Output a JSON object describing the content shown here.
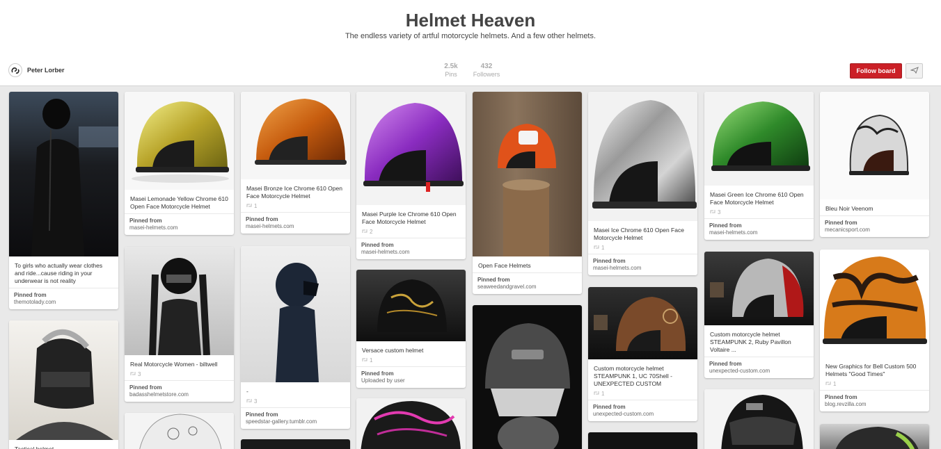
{
  "board": {
    "title": "Helmet Heaven",
    "description": "The endless variety of artful motorcycle helmets. And a few other helmets."
  },
  "owner": {
    "name": "Peter Lorber"
  },
  "stats": {
    "pins_count": "2.5k",
    "pins_label": "Pins",
    "followers_count": "432",
    "followers_label": "Followers"
  },
  "actions": {
    "follow_label": "Follow board"
  },
  "pinned_from_label": "Pinned from",
  "uploaded_by_user_label": "Uploaded by user",
  "pins": [
    {
      "description": "To girls who actually wear clothes and ride...cause riding in your underwear is not reality",
      "repins": "",
      "source": "themotolady.com",
      "image": "woman-leather-helmet"
    },
    {
      "description": "Tactical helmet",
      "repins": "",
      "source": "",
      "image": "tactical-helmet"
    },
    {
      "description": "Masei Lemonade Yellow Chrome 610 Open Face Motorcycle Helmet",
      "repins": "",
      "source": "masei-helmets.com",
      "image": "yellow-chrome-helmet"
    },
    {
      "description": "Real Motorcycle Women - biltwell",
      "repins": "3",
      "source": "badasshelmetstore.com",
      "image": "woman-black-helmet"
    },
    {
      "description": "",
      "repins": "",
      "source": "",
      "image": "white-skull-helmet"
    },
    {
      "description": "Masei Bronze Ice Chrome 610 Open Face Motorcycle Helmet",
      "repins": "1",
      "source": "masei-helmets.com",
      "image": "bronze-chrome-helmet"
    },
    {
      "description": "-",
      "repins": "3",
      "source": "speedstar-gallery.tumblr.com",
      "image": "woman-blue-helmet"
    },
    {
      "description": "",
      "repins": "",
      "source": "",
      "image": "dark-image"
    },
    {
      "description": "Masei Purple Ice Chrome 610 Open Face Motorcycle Helmet",
      "repins": "2",
      "source": "masei-helmets.com",
      "image": "purple-chrome-helmet"
    },
    {
      "description": "Versace custom helmet",
      "repins": "1",
      "source": "",
      "uploaded": true,
      "image": "versace-helmet"
    },
    {
      "description": "",
      "repins": "",
      "source": "",
      "image": "pink-floral-helmet"
    },
    {
      "description": "Open Face Helmets",
      "repins": "",
      "source": "seaweedandgravel.com",
      "image": "orange-helmet-stump"
    },
    {
      "description": "",
      "repins": "",
      "source": "",
      "image": "roof-helmet-man"
    },
    {
      "description": "Masei Ice Chrome 610 Open Face Motorcycle Helmet",
      "repins": "1",
      "source": "masei-helmets.com",
      "image": "silver-chrome-helmet"
    },
    {
      "description": "Custom motorcycle helmet STEAMPUNK 1, UC 70Shell - UNEXPECTED CUSTOM",
      "repins": "1",
      "source": "unexpected-custom.com",
      "image": "steampunk-helmet-1"
    },
    {
      "description": "",
      "repins": "",
      "source": "",
      "image": "dark-image"
    },
    {
      "description": "Masei Green Ice Chrome 610 Open Face Motorcycle Helmet",
      "repins": "3",
      "source": "masei-helmets.com",
      "image": "green-chrome-helmet"
    },
    {
      "description": "Custom motorcycle helmet STEAMPUNK 2, Ruby Pavillon Voltaire ...",
      "repins": "",
      "source": "unexpected-custom.com",
      "image": "steampunk-helmet-2"
    },
    {
      "description": "",
      "repins": "",
      "source": "",
      "image": "black-fullface-helmet"
    },
    {
      "description": "Bleu Noir Veenom",
      "repins": "",
      "source": "mecanicsport.com",
      "image": "bleu-noir-helmet"
    },
    {
      "description": "New Graphics for Bell Custom 500 Helmets \"Good Times\"",
      "repins": "1",
      "source": "blog.revzilla.com",
      "image": "good-times-helmet"
    },
    {
      "description": "",
      "repins": "",
      "source": "",
      "image": "green-helmet-partial"
    }
  ]
}
